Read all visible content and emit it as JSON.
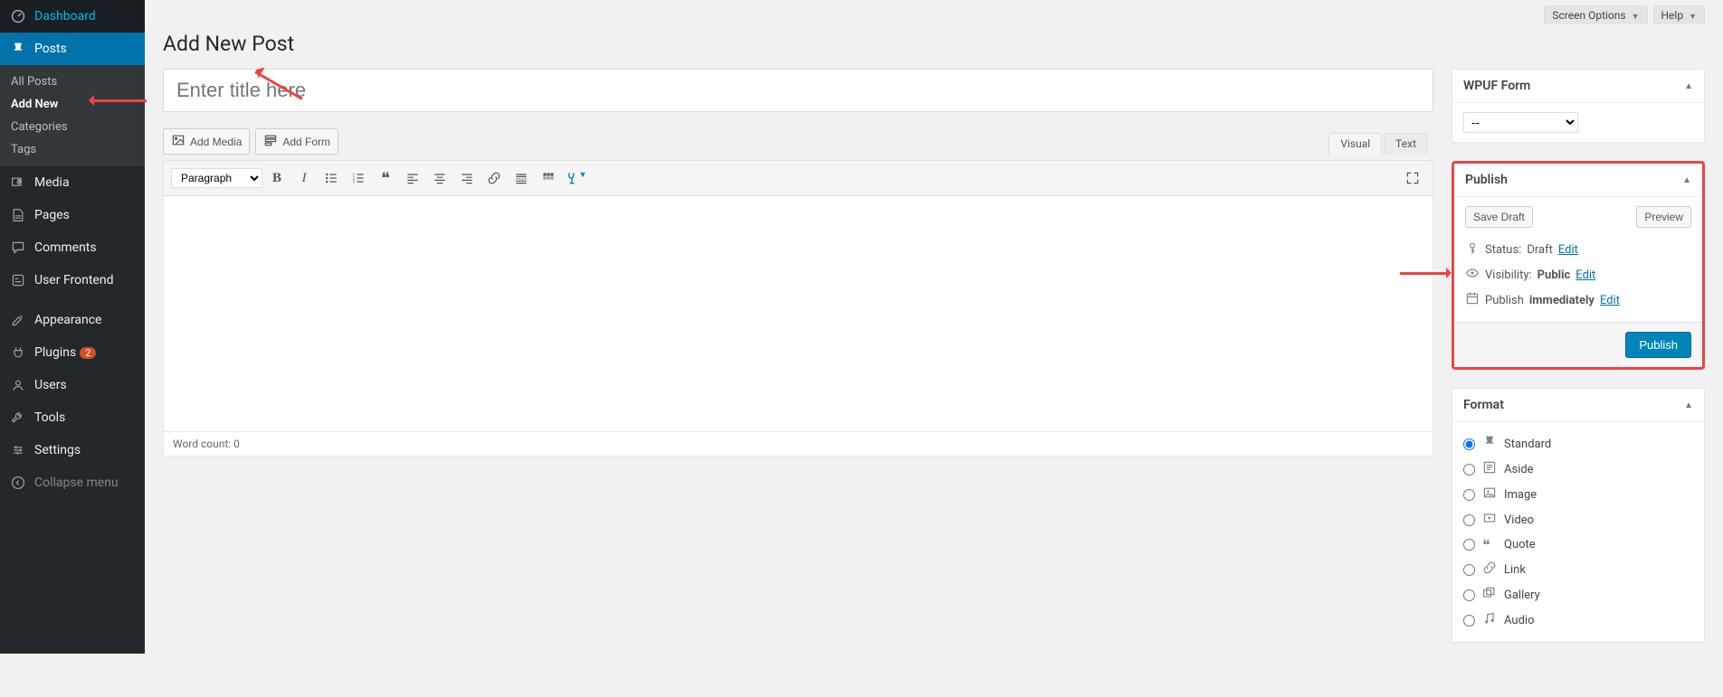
{
  "topTabs": {
    "screenOptions": "Screen Options",
    "help": "Help"
  },
  "sidebar": {
    "items": [
      {
        "label": "Dashboard"
      },
      {
        "label": "Posts"
      },
      {
        "label": "Media"
      },
      {
        "label": "Pages"
      },
      {
        "label": "Comments"
      },
      {
        "label": "User Frontend"
      },
      {
        "label": "Appearance"
      },
      {
        "label": "Plugins",
        "badge": "2"
      },
      {
        "label": "Users"
      },
      {
        "label": "Tools"
      },
      {
        "label": "Settings"
      },
      {
        "label": "Collapse menu"
      }
    ],
    "postsSubmenu": [
      {
        "label": "All Posts"
      },
      {
        "label": "Add New"
      },
      {
        "label": "Categories"
      },
      {
        "label": "Tags"
      }
    ]
  },
  "pageTitle": "Add New Post",
  "titlePlaceholder": "Enter title here",
  "addMedia": "Add Media",
  "addForm": "Add Form",
  "editor": {
    "formatDropdown": "Paragraph",
    "tabs": {
      "visual": "Visual",
      "text": "Text"
    },
    "wordCount": "Word count: 0"
  },
  "wpuf": {
    "title": "WPUF Form",
    "selected": "--"
  },
  "publish": {
    "title": "Publish",
    "saveDraft": "Save Draft",
    "preview": "Preview",
    "statusLabel": "Status:",
    "statusValue": "Draft",
    "visibilityLabel": "Visibility:",
    "visibilityValue": "Public",
    "publishLabel": "Publish",
    "publishValue": "immediately",
    "edit": "Edit",
    "button": "Publish"
  },
  "format": {
    "title": "Format",
    "options": [
      "Standard",
      "Aside",
      "Image",
      "Video",
      "Quote",
      "Link",
      "Gallery",
      "Audio"
    ]
  }
}
